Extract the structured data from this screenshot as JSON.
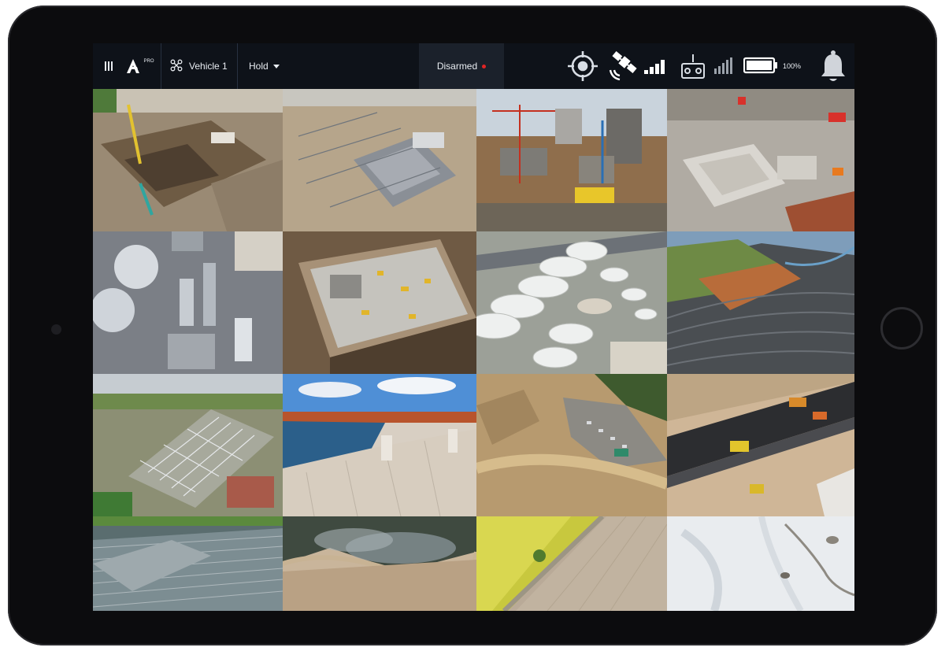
{
  "topbar": {
    "menu_icon": "menu-icon",
    "logo_icon": "app-logo-icon",
    "logo_text": "PRO",
    "vehicle_icon": "drone-icon",
    "vehicle_label": "Vehicle 1",
    "flight_mode": "Hold",
    "arm_status": "Disarmed",
    "arm_status_color": "#e02424",
    "target_icon": "crosshair-icon",
    "gps_icon": "satellite-icon",
    "rc_icon": "remote-controller-icon",
    "battery_label": "100%",
    "battery_level": 1.0,
    "notification_icon": "bell-icon"
  },
  "tiles": [
    {
      "name": "tile-excavation-site"
    },
    {
      "name": "tile-steel-frame-site"
    },
    {
      "name": "tile-highrise-construction"
    },
    {
      "name": "tile-foundation-site"
    },
    {
      "name": "tile-industrial-plant"
    },
    {
      "name": "tile-concrete-structure"
    },
    {
      "name": "tile-oil-storage-tanks"
    },
    {
      "name": "tile-open-pit-mine"
    },
    {
      "name": "tile-power-substation"
    },
    {
      "name": "tile-hydro-dam"
    },
    {
      "name": "tile-earthworks-site"
    },
    {
      "name": "tile-road-paving"
    },
    {
      "name": "tile-greenhouses"
    },
    {
      "name": "tile-wildfire"
    },
    {
      "name": "tile-farmland-road"
    },
    {
      "name": "tile-snowy-terrain"
    }
  ]
}
